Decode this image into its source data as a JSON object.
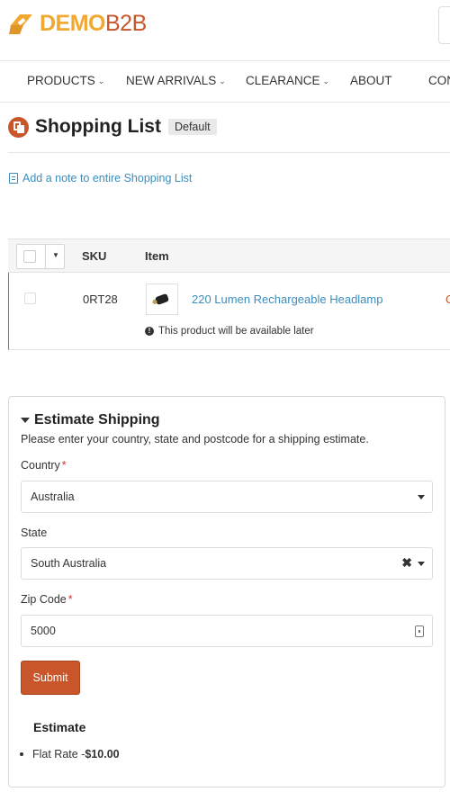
{
  "header": {
    "logo_demo": "DEMO",
    "logo_b2b": "B2B"
  },
  "nav": {
    "items": [
      {
        "label": "PRODUCTS",
        "has_caret": true
      },
      {
        "label": "NEW ARRIVALS",
        "has_caret": true
      },
      {
        "label": "CLEARANCE",
        "has_caret": true
      },
      {
        "label": "ABOUT",
        "has_caret": false
      },
      {
        "label": "CON",
        "has_caret": false
      }
    ]
  },
  "page": {
    "title": "Shopping List",
    "badge": "Default",
    "note_link": "Add a note to entire Shopping List"
  },
  "table": {
    "columns": [
      "SKU",
      "Item"
    ],
    "rows": [
      {
        "sku": "0RT28",
        "item": "220 Lumen Rechargeable Headlamp",
        "availability": "This product will be available later",
        "peek": "C"
      }
    ]
  },
  "estimate": {
    "title": "Estimate Shipping",
    "description": "Please enter your country, state and postcode for a shipping estimate.",
    "country_label": "Country",
    "country_value": "Australia",
    "state_label": "State",
    "state_value": "South Australia",
    "zip_label": "Zip Code",
    "zip_value": "5000",
    "required_mark": "*",
    "submit_label": "Submit",
    "result_title": "Estimate",
    "result_method": "Flat Rate - ",
    "result_price": "$10.00"
  },
  "colors": {
    "brand_orange": "#c8562a",
    "brand_yellow": "#f0a830",
    "link_blue": "#3c8dbc"
  }
}
